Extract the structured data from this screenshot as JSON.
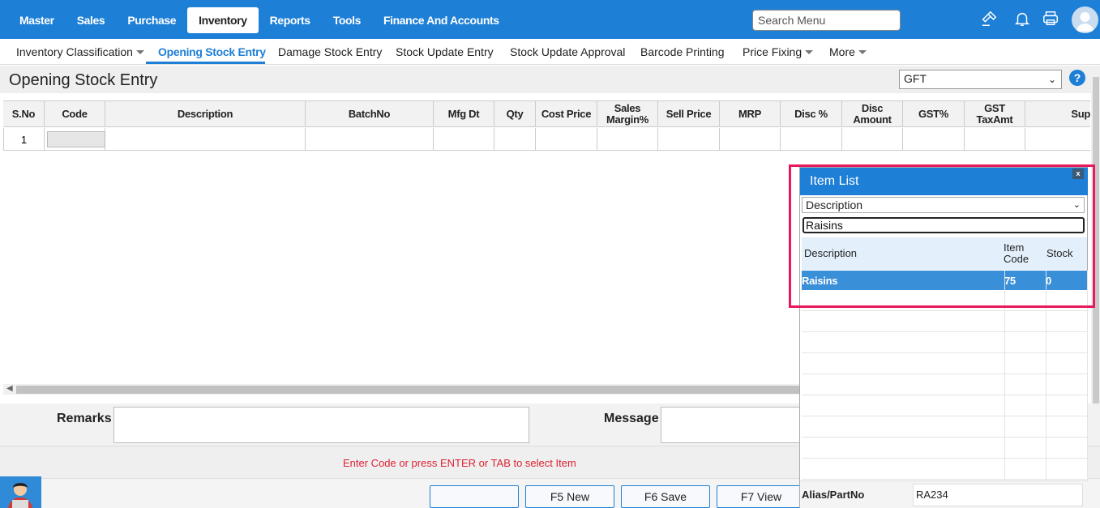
{
  "topnav": {
    "items": [
      "Master",
      "Sales",
      "Purchase",
      "Inventory",
      "Reports",
      "Tools",
      "Finance And Accounts"
    ],
    "active": "Inventory",
    "search_placeholder": "Search Menu"
  },
  "subnav": {
    "items": [
      "Inventory Classification",
      "Opening Stock Entry",
      "Damage Stock Entry",
      "Stock Update Entry",
      "Stock Update Approval",
      "Barcode Printing",
      "Price Fixing",
      "More"
    ],
    "active": "Opening Stock Entry"
  },
  "page": {
    "title": "Opening Stock Entry",
    "branch_value": "GFT",
    "help": "?"
  },
  "grid": {
    "columns": [
      "S.No",
      "Code",
      "Description",
      "BatchNo",
      "Mfg Dt",
      "Qty",
      "Cost Price",
      "Sales Margin%",
      "Sell Price",
      "MRP",
      "Disc %",
      "Disc Amount",
      "GST%",
      "GST TaxAmt",
      "Sup"
    ],
    "rows": [
      [
        "1",
        "",
        "",
        "",
        "",
        "",
        "",
        "",
        "",
        "",
        "",
        "",
        "",
        "",
        ""
      ]
    ]
  },
  "form": {
    "remarks_label": "Remarks",
    "message_label": "Message",
    "status_text": "Enter Code or press ENTER or TAB to select Item"
  },
  "footer": {
    "buttons": [
      "",
      "F5 New",
      "F6 Save",
      "F7 View"
    ]
  },
  "item_list": {
    "title": "Item List",
    "close": "x",
    "search_by": "Description",
    "search_value": "Raisins",
    "columns": [
      "Description",
      "Item Code",
      "Stock"
    ],
    "rows": [
      [
        "Raisins",
        "75",
        "0"
      ]
    ],
    "alias_label": "Alias/PartNo",
    "alias_value": "RA234"
  },
  "colors": {
    "primary": "#1e7fd6",
    "highlight": "#e8185a",
    "status_text": "#dd2233",
    "selected_row": "#3a8fd9"
  }
}
